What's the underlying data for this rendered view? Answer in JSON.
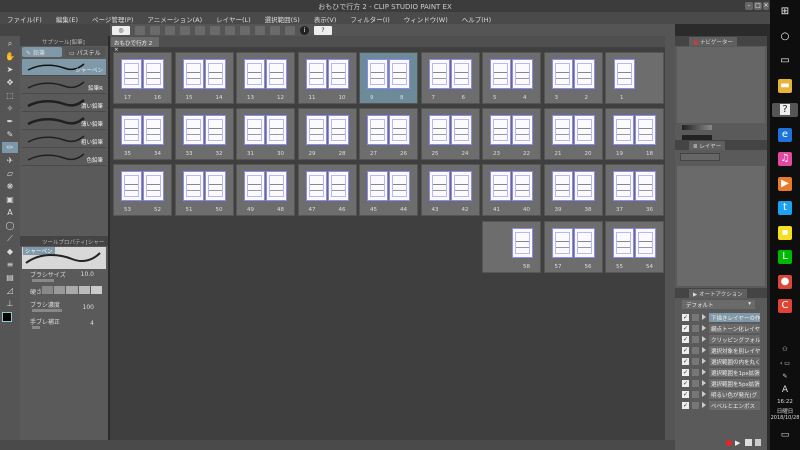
{
  "window": {
    "title": "おもひで行方 2 - CLIP STUDIO PAINT EX"
  },
  "menu": [
    "ファイル(F)",
    "編集(E)",
    "ページ管理(P)",
    "アニメーション(A)",
    "レイヤー(L)",
    "選択範囲(S)",
    "表示(V)",
    "フィルター(I)",
    "ウィンドウ(W)",
    "ヘルプ(H)"
  ],
  "document_tab": "おもひで行方 2",
  "subtool": {
    "panel_title": "サブツール[鉛筆]",
    "tabs": [
      "鉛筆",
      "パステル"
    ],
    "brushes": [
      "シャーペン",
      "鉛筆R",
      "濃い鉛筆",
      "薄い鉛筆",
      "粗い鉛筆",
      "色鉛筆"
    ],
    "selected": 0
  },
  "tool_property": {
    "panel_title": "ツールプロパティ[シャーペン]",
    "preview_label": "シャーペン",
    "brush_size_label": "ブラシサイズ",
    "brush_size": "10.0",
    "hardness_label": "硬さ",
    "brush_density_label": "ブラシ濃度",
    "brush_density": "100",
    "stabilization_label": "手ブレ補正",
    "stabilization": "4"
  },
  "pages": {
    "selected": "9-8",
    "rows": [
      [
        [
          "17",
          "16"
        ],
        [
          "15",
          "14"
        ],
        [
          "13",
          "12"
        ],
        [
          "11",
          "10"
        ],
        [
          "9",
          "8"
        ],
        [
          "7",
          "6"
        ],
        [
          "5",
          "4"
        ],
        [
          "3",
          "2"
        ],
        [
          "1",
          ""
        ]
      ],
      [
        [
          "35",
          "34"
        ],
        [
          "33",
          "32"
        ],
        [
          "31",
          "30"
        ],
        [
          "29",
          "28"
        ],
        [
          "27",
          "26"
        ],
        [
          "25",
          "24"
        ],
        [
          "23",
          "22"
        ],
        [
          "21",
          "20"
        ],
        [
          "19",
          "18"
        ]
      ],
      [
        [
          "53",
          "52"
        ],
        [
          "51",
          "50"
        ],
        [
          "49",
          "48"
        ],
        [
          "47",
          "46"
        ],
        [
          "45",
          "44"
        ],
        [
          "43",
          "42"
        ],
        [
          "41",
          "40"
        ],
        [
          "39",
          "38"
        ],
        [
          "37",
          "36"
        ]
      ],
      [
        null,
        null,
        null,
        null,
        null,
        null,
        [
          "",
          "58"
        ],
        [
          "57",
          "56"
        ],
        [
          "55",
          "54"
        ]
      ]
    ]
  },
  "navigator": {
    "title": "ナビゲーター"
  },
  "layer": {
    "title": "レイヤー"
  },
  "auto_action": {
    "title": "オートアクション",
    "set": "デフォルト",
    "items": [
      "下描きレイヤーの作成",
      "網点トーン化レイヤー",
      "クリッピングフォルダー",
      "選択対象を別レイヤー",
      "選択範囲の内を丸く",
      "選択範囲を1px拡張",
      "選択範囲を5px拡張",
      "明るい色が発光(グ",
      "ベベルとエンボス"
    ],
    "selected": 0
  },
  "taskbar": {
    "time": "16:22",
    "day": "日曜日",
    "date": "2018/10/28",
    "icons": [
      "windows-icon",
      "cortana-icon",
      "task-view-icon",
      "file-explorer-icon",
      "clip-studio-icon",
      "edge-icon",
      "itunes-icon",
      "media-player-icon",
      "twitter-icon",
      "sticky-notes-icon",
      "line-icon",
      "chrome-icon",
      "ccleaner-icon"
    ],
    "ime": "A"
  },
  "colors": {
    "accent_selected": "#7f99a8",
    "canvas_bg": "#3f3f3f",
    "page_border": "#8a8af0"
  }
}
